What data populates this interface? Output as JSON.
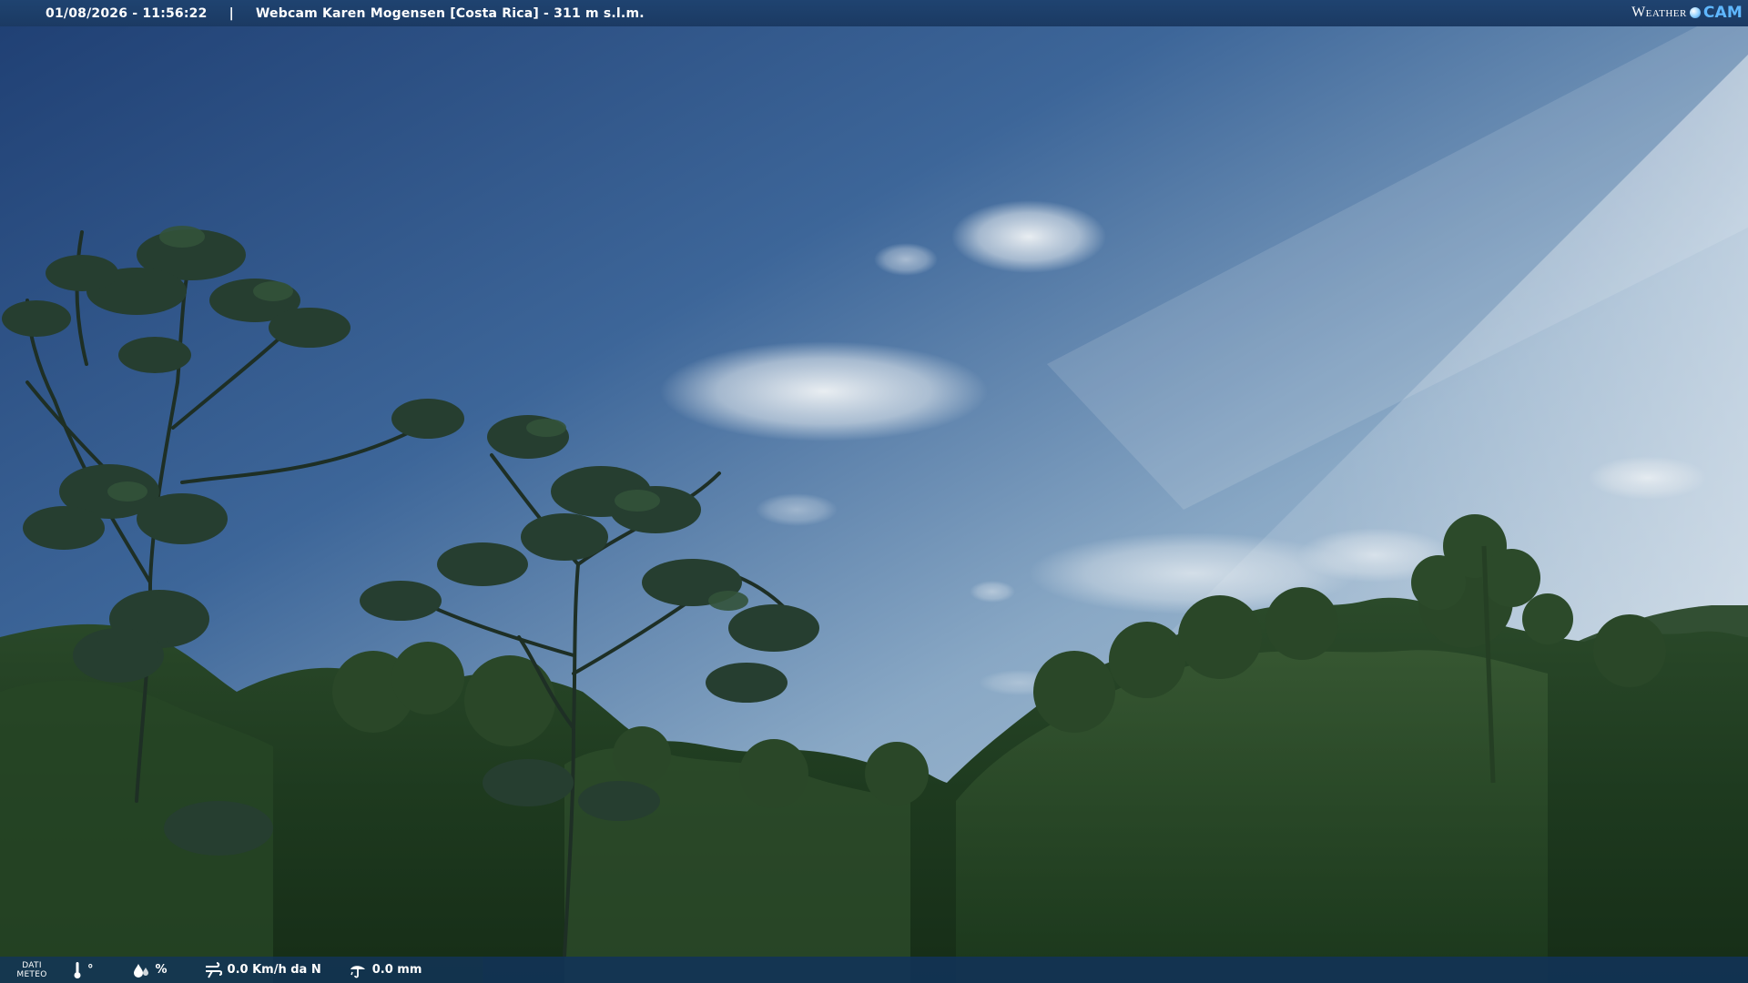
{
  "overlay": {
    "datetime": "01/08/2026 - 11:56:22",
    "separator": "|",
    "title": "Webcam Karen Mogensen [Costa Rica] - 311 m s.l.m."
  },
  "logo": {
    "weather": "Weather",
    "cam": "CAM"
  },
  "meteo": {
    "label_line1": "DATI",
    "label_line2": "METEO",
    "temperature": "°",
    "humidity": "%",
    "wind": "0.0 Km/h da N",
    "rain": "0.0 mm"
  },
  "colors": {
    "bar": "#1f4370",
    "accent": "#5fb7ff"
  },
  "icons": {
    "temperature": "thermometer-icon",
    "humidity": "humidity-icon",
    "wind": "wind-icon",
    "rain": "rain-icon"
  }
}
